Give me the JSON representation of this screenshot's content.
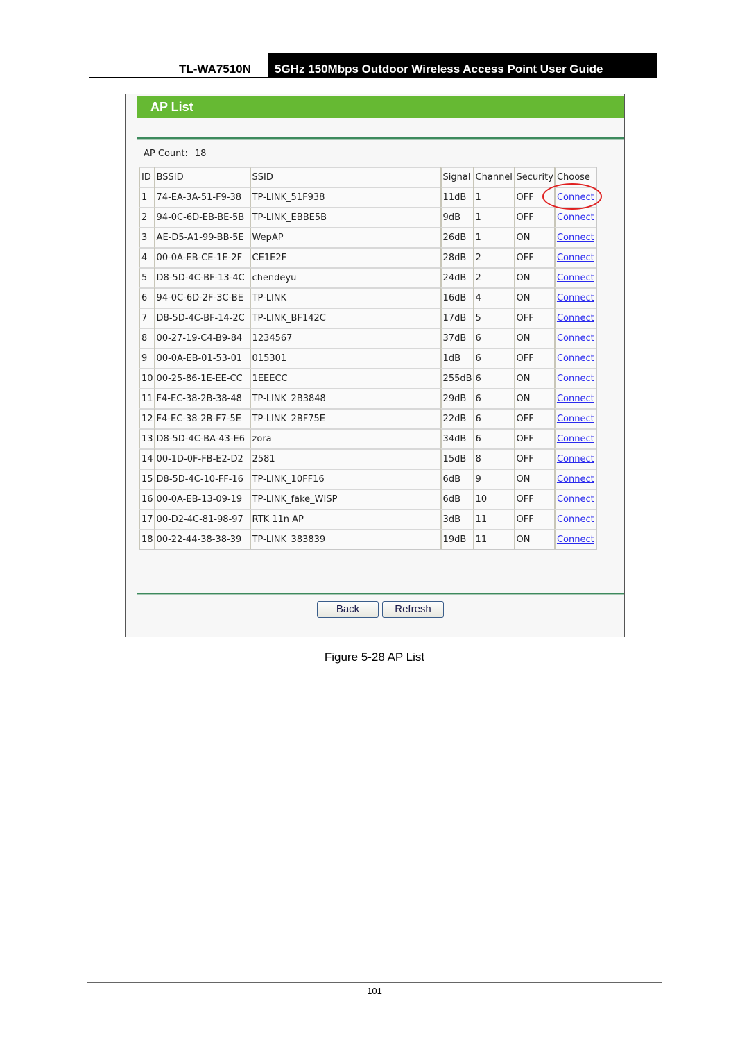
{
  "header": {
    "model": "TL-WA7510N",
    "guide_title": "5GHz 150Mbps Outdoor Wireless Access Point User Guide"
  },
  "panel": {
    "title": "AP List",
    "ap_count_label": "AP Count:",
    "ap_count_value": "18",
    "columns": [
      "ID",
      "BSSID",
      "SSID",
      "Signal",
      "Channel",
      "Security",
      "Choose"
    ],
    "rows": [
      {
        "id": "1",
        "bssid": "74-EA-3A-51-F9-38",
        "ssid": "TP-LINK_51F938",
        "signal": "11dB",
        "channel": "1",
        "security": "OFF",
        "choose": "Connect"
      },
      {
        "id": "2",
        "bssid": "94-0C-6D-EB-BE-5B",
        "ssid": "TP-LINK_EBBE5B",
        "signal": "9dB",
        "channel": "1",
        "security": "OFF",
        "choose": "Connect"
      },
      {
        "id": "3",
        "bssid": "AE-D5-A1-99-BB-5E",
        "ssid": "WepAP",
        "signal": "26dB",
        "channel": "1",
        "security": "ON",
        "choose": "Connect"
      },
      {
        "id": "4",
        "bssid": "00-0A-EB-CE-1E-2F",
        "ssid": "CE1E2F",
        "signal": "28dB",
        "channel": "2",
        "security": "OFF",
        "choose": "Connect"
      },
      {
        "id": "5",
        "bssid": "D8-5D-4C-BF-13-4C",
        "ssid": "chendeyu",
        "signal": "24dB",
        "channel": "2",
        "security": "ON",
        "choose": "Connect"
      },
      {
        "id": "6",
        "bssid": "94-0C-6D-2F-3C-BE",
        "ssid": "TP-LINK",
        "signal": "16dB",
        "channel": "4",
        "security": "ON",
        "choose": "Connect"
      },
      {
        "id": "7",
        "bssid": "D8-5D-4C-BF-14-2C",
        "ssid": "TP-LINK_BF142C",
        "signal": "17dB",
        "channel": "5",
        "security": "OFF",
        "choose": "Connect"
      },
      {
        "id": "8",
        "bssid": "00-27-19-C4-B9-84",
        "ssid": "1234567",
        "signal": "37dB",
        "channel": "6",
        "security": "ON",
        "choose": "Connect"
      },
      {
        "id": "9",
        "bssid": "00-0A-EB-01-53-01",
        "ssid": "015301",
        "signal": "1dB",
        "channel": "6",
        "security": "OFF",
        "choose": "Connect"
      },
      {
        "id": "10",
        "bssid": "00-25-86-1E-EE-CC",
        "ssid": "1EEECC",
        "signal": "255dB",
        "channel": "6",
        "security": "ON",
        "choose": "Connect"
      },
      {
        "id": "11",
        "bssid": "F4-EC-38-2B-38-48",
        "ssid": "TP-LINK_2B3848",
        "signal": "29dB",
        "channel": "6",
        "security": "ON",
        "choose": "Connect"
      },
      {
        "id": "12",
        "bssid": "F4-EC-38-2B-F7-5E",
        "ssid": "TP-LINK_2BF75E",
        "signal": "22dB",
        "channel": "6",
        "security": "OFF",
        "choose": "Connect"
      },
      {
        "id": "13",
        "bssid": "D8-5D-4C-BA-43-E6",
        "ssid": "zora",
        "signal": "34dB",
        "channel": "6",
        "security": "OFF",
        "choose": "Connect"
      },
      {
        "id": "14",
        "bssid": "00-1D-0F-FB-E2-D2",
        "ssid": "2581",
        "signal": "15dB",
        "channel": "8",
        "security": "OFF",
        "choose": "Connect"
      },
      {
        "id": "15",
        "bssid": "D8-5D-4C-10-FF-16",
        "ssid": "TP-LINK_10FF16",
        "signal": "6dB",
        "channel": "9",
        "security": "ON",
        "choose": "Connect"
      },
      {
        "id": "16",
        "bssid": "00-0A-EB-13-09-19",
        "ssid": "TP-LINK_fake_WISP",
        "signal": "6dB",
        "channel": "10",
        "security": "OFF",
        "choose": "Connect"
      },
      {
        "id": "17",
        "bssid": "00-D2-4C-81-98-97",
        "ssid": "RTK 11n AP",
        "signal": "3dB",
        "channel": "11",
        "security": "OFF",
        "choose": "Connect"
      },
      {
        "id": "18",
        "bssid": "00-22-44-38-38-39",
        "ssid": "TP-LINK_383839",
        "signal": "19dB",
        "channel": "11",
        "security": "ON",
        "choose": "Connect"
      }
    ],
    "buttons": {
      "back": "Back",
      "refresh": "Refresh"
    }
  },
  "caption": "Figure 5-28 AP List",
  "page_number": "101"
}
